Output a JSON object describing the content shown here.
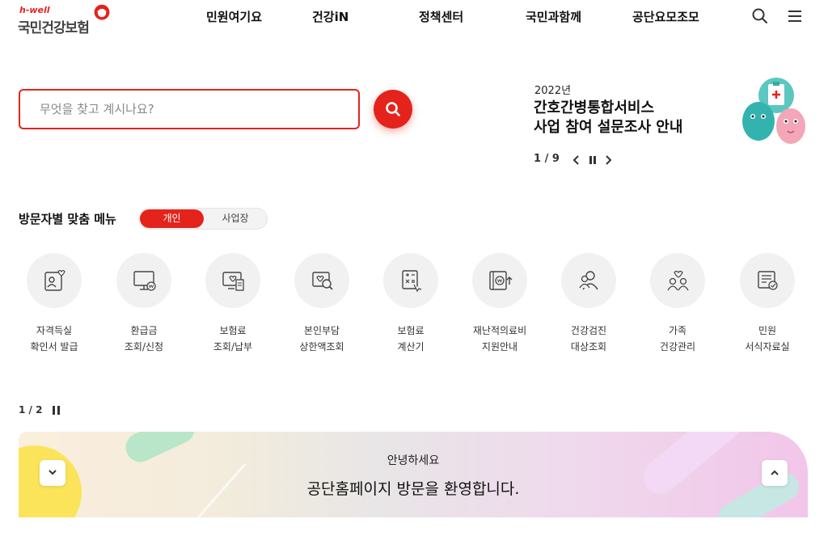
{
  "header": {
    "logo_small": "h-well",
    "logo_main": "국민건강보험",
    "nav": [
      "민원여기요",
      "건강iN",
      "정책센터",
      "국민과함께",
      "공단요모조모"
    ],
    "icons": [
      "search-icon",
      "hamburger-menu-icon"
    ]
  },
  "search": {
    "placeholder": "무엇을 찾고 계시나요?"
  },
  "promo": {
    "year": "2022년",
    "title_line1": "간호간병통합서비스",
    "title_line2": "사업 참여 설문조사 안내",
    "counter": "1 / 9"
  },
  "visitor": {
    "title": "방문자별 맞춤 메뉴",
    "toggle_on": "개인",
    "toggle_off": "사업장",
    "items": [
      {
        "l1": "자격득실",
        "l2": "확인서 발급",
        "icon": "id-card-icon"
      },
      {
        "l1": "환급금",
        "l2": "조회/신청",
        "icon": "refund-monitor-icon"
      },
      {
        "l1": "보험료",
        "l2": "조회/납부",
        "icon": "premium-bill-icon"
      },
      {
        "l1": "본인부담",
        "l2": "상한액조회",
        "icon": "copay-search-icon"
      },
      {
        "l1": "보험료",
        "l2": "계산기",
        "icon": "calculator-icon"
      },
      {
        "l1": "재난적의료비",
        "l2": "지원안내",
        "icon": "medical-support-icon"
      },
      {
        "l1": "건강검진",
        "l2": "대상조회",
        "icon": "checkup-people-icon"
      },
      {
        "l1": "가족",
        "l2": "건강관리",
        "icon": "family-health-icon"
      },
      {
        "l1": "민원",
        "l2": "서식자료실",
        "icon": "forms-library-icon"
      }
    ],
    "pager": "1 / 2"
  },
  "banner": {
    "hello": "안녕하세요",
    "welcome": "공단홈페이지 방문을 환영합니다."
  },
  "colors": {
    "accent": "#e4241c",
    "text": "#222222",
    "circle_bg": "#f1f1f1"
  }
}
